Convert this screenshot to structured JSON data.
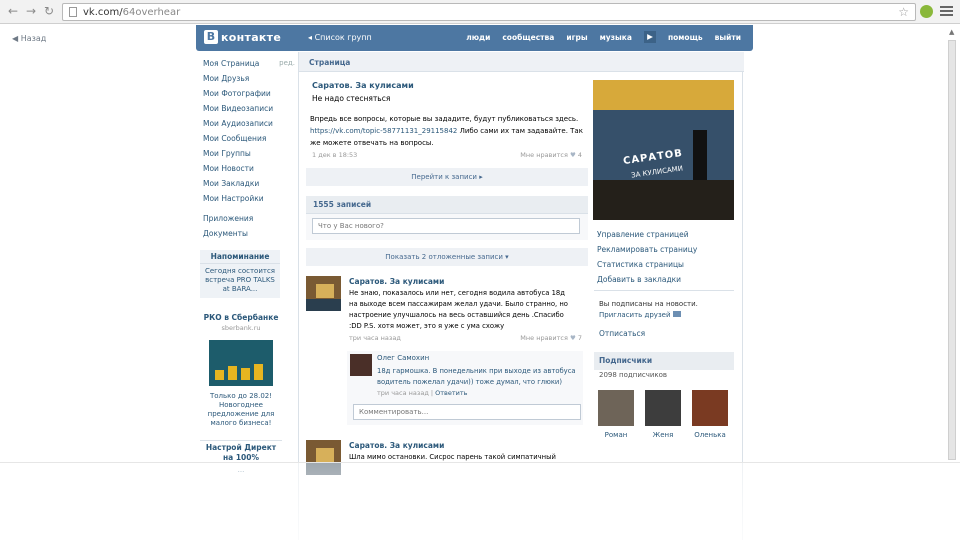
{
  "browser": {
    "url_host": "vk.com/",
    "url_path": "64overhear"
  },
  "back_label": "Назад",
  "header": {
    "logo_text": "контакте",
    "logo_letter": "В",
    "groups_link": "Список групп",
    "nav": [
      "люди",
      "сообщества",
      "игры",
      "музыка",
      "помощь",
      "выйти"
    ]
  },
  "left_menu": {
    "items": [
      "Моя Страница",
      "Мои Друзья",
      "Мои Фотографии",
      "Мои Видеозаписи",
      "Мои Аудиозаписи",
      "Мои Сообщения",
      "Мои Группы",
      "Мои Новости",
      "Мои Закладки",
      "Мои Настройки"
    ],
    "edit": "ред.",
    "extra": [
      "Приложения",
      "Документы"
    ]
  },
  "reminder": {
    "title": "Напоминание",
    "text1": "Сегодня состоится",
    "text2": "встреча PRO TALKS",
    "text3": "at BARA..."
  },
  "ad": {
    "title": "РКО в Сбербанке",
    "domain": "sberbank.ru",
    "text1": "Только до 28.02!",
    "text2": "Новогоднее",
    "text3": "предложение для",
    "text4": "малого бизнеса!"
  },
  "ad2": {
    "title": "Настрой Директ на 100%",
    "text": "..."
  },
  "page": {
    "crumb": "Страница",
    "group_name": "Саратов. За кулисами",
    "status": "Не надо стесняться",
    "pinned_line1": "Впредь все вопросы, которые вы зададите, будут публиковаться здесь.",
    "pinned_link": "https://vk.com/topic-58771131_29115842",
    "pinned_line2": " Либо сами их там задавайте. Так",
    "pinned_line3": "же можете отвечать на вопросы.",
    "pinned_time": "1 дек в 18:53",
    "pinned_likes": "Мне нравится",
    "pinned_likes_count": "4",
    "goto_btn": "Перейти к записи ▸",
    "wall_count": "1555 записей",
    "compose_placeholder": "Что у Вас нового?",
    "show_postponed": "Показать 2 отложенные записи ▾"
  },
  "post1": {
    "author": "Саратов. За кулисами",
    "line1": "Не знаю, показалось или нет, сегодня водила автобуса 18д",
    "line2": "на выходе всем пассажирам желал удачи. Было странно, но",
    "line3": "настроение улучшалось на весь оставшийся день .Спасибо",
    "line4": ":DD P.S. хотя может, это я уже с ума схожу",
    "time": "три часа назад",
    "likes": "Мне нравится",
    "likes_count": "7"
  },
  "reply": {
    "author": "Олег Самохин",
    "line1": "18д гармошка. В понедельник при выходе из автобуса",
    "line2": "водитель пожелал удачи)) тоже думал, что глюки)",
    "time": "три часа назад",
    "reply_link": "Ответить",
    "comment_placeholder": "Комментировать..."
  },
  "post2": {
    "author": "Саратов. За кулисами",
    "line1": "Шла мимо остановки. Сисрос парень такой симпатичный"
  },
  "cover": {
    "title": "САРАТОВ",
    "subtitle": "ЗА КУЛИСАМИ"
  },
  "side_links": [
    "Управление страницей",
    "Рекламировать страницу",
    "Статистика страницы",
    "Добавить в закладки"
  ],
  "subscribe": {
    "text": "Вы подписаны на новости.",
    "invite": "Пригласить друзей",
    "unsubscribe": "Отписаться"
  },
  "subscribers": {
    "title": "Подписчики",
    "count": "2098 подписчиков",
    "people": [
      {
        "name": "Роман",
        "color": "#6e6458"
      },
      {
        "name": "Женя",
        "color": "#3d3d3d"
      },
      {
        "name": "Оленька",
        "color": "#7a3a22"
      }
    ]
  }
}
